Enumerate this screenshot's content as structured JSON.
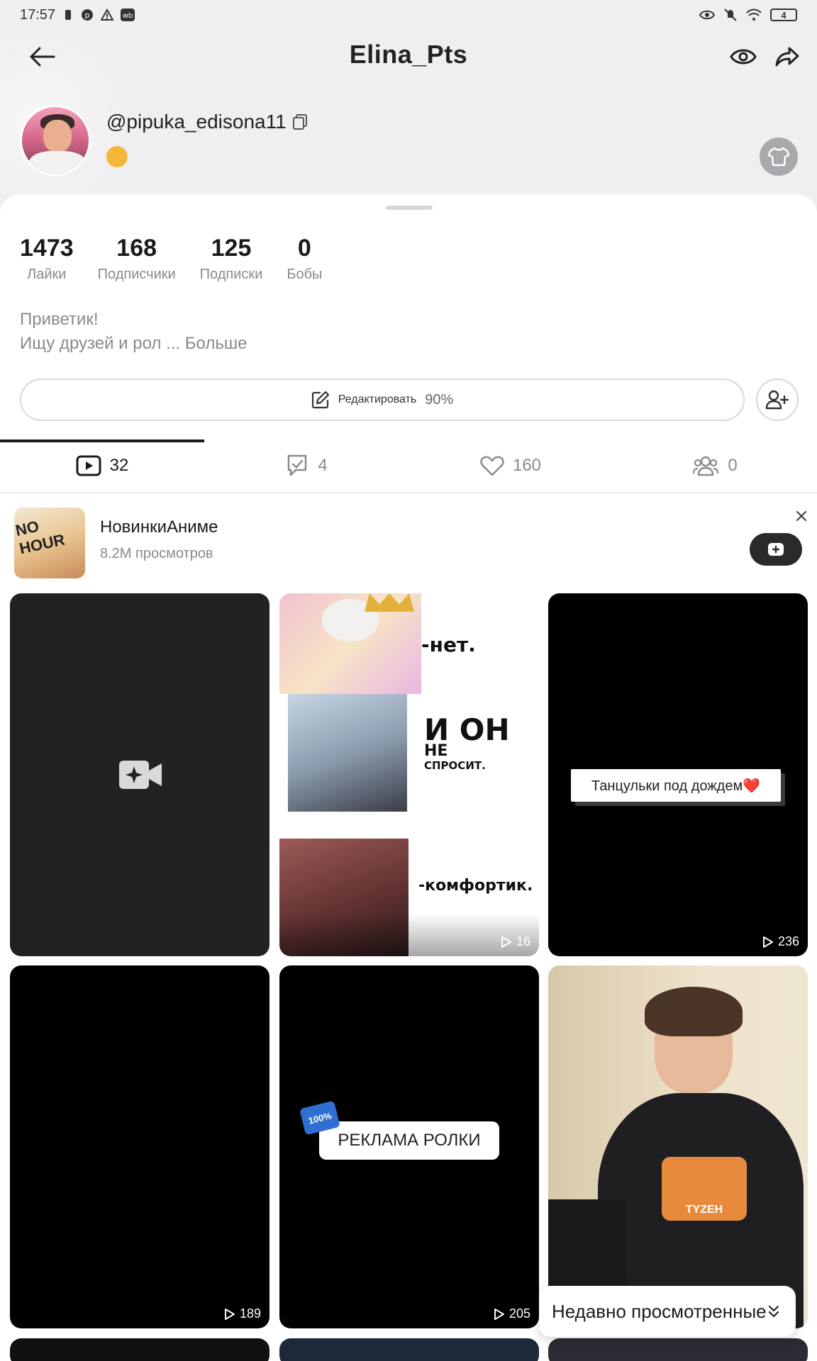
{
  "status_bar": {
    "time": "17:57",
    "battery": "4"
  },
  "header": {
    "title": "Elina_Pts"
  },
  "profile": {
    "handle": "@pipuka_edisona11"
  },
  "stats": [
    {
      "value": "1473",
      "label": "Лайки"
    },
    {
      "value": "168",
      "label": "Подписчики"
    },
    {
      "value": "125",
      "label": "Подписки"
    },
    {
      "value": "0",
      "label": "Бобы"
    }
  ],
  "bio": {
    "line1": "Приветик!",
    "line2": "Ищу друзей и рол ...",
    "more": "Больше"
  },
  "edit": {
    "label": "Редактировать",
    "percent": "90%"
  },
  "tabs": [
    {
      "icon": "video-icon",
      "count": "32"
    },
    {
      "icon": "repost-icon",
      "count": "4"
    },
    {
      "icon": "heart-icon",
      "count": "160"
    },
    {
      "icon": "group-icon",
      "count": "0"
    }
  ],
  "featured": {
    "title": "НовинкиАниме",
    "subtitle": "8.2M просмотров",
    "thumb_text": "NO HOUR"
  },
  "grid": {
    "cell2": {
      "line1": "-нет.",
      "line2": "И ОН",
      "line3": "НЕ",
      "line4": "СПРОСИТ.",
      "line5": "-комфортик.",
      "views": "16"
    },
    "cell3": {
      "caption": "Танцульки под дождем❤️",
      "views": "236"
    },
    "cell4": {
      "views": "189"
    },
    "cell5": {
      "caption": "РЕКЛАМА РОЛКИ",
      "badge": "100%",
      "views": "205"
    },
    "cell6": {
      "shirt_text": "TYZEH"
    }
  },
  "recent": {
    "label": "Недавно просмотренные"
  },
  "colors": {
    "accent": "#1a1a1a",
    "muted": "#8a8a8e",
    "sheet": "#ffffff",
    "header_bg": "#efeff1"
  }
}
